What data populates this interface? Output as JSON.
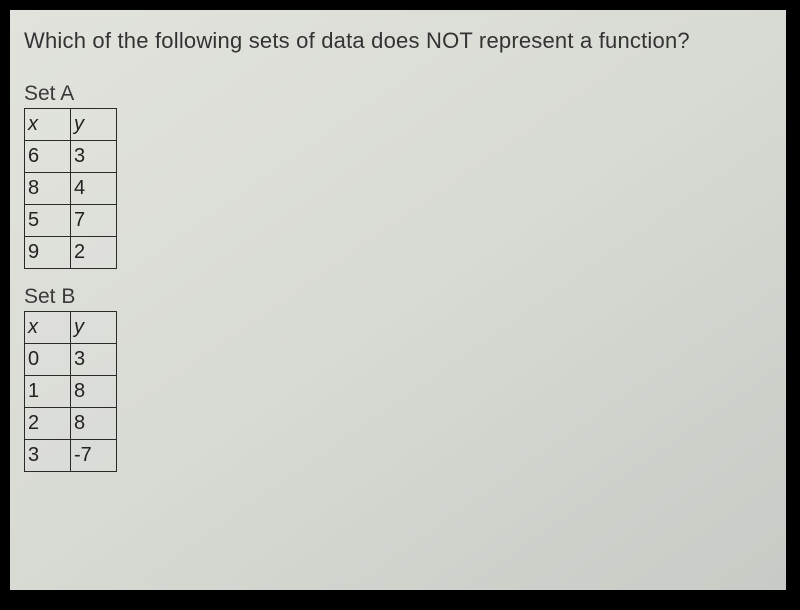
{
  "question": "Which of the following sets of data does NOT represent a function?",
  "sets": {
    "a": {
      "label": "Set A",
      "headers": {
        "x": "x",
        "y": "y"
      },
      "rows": [
        {
          "x": "6",
          "y": "3"
        },
        {
          "x": "8",
          "y": "4"
        },
        {
          "x": "5",
          "y": "7"
        },
        {
          "x": "9",
          "y": "2"
        }
      ]
    },
    "b": {
      "label": "Set B",
      "headers": {
        "x": "x",
        "y": "y"
      },
      "rows": [
        {
          "x": "0",
          "y": "3"
        },
        {
          "x": "1",
          "y": "8"
        },
        {
          "x": "2",
          "y": "8"
        },
        {
          "x": "3",
          "y": "-7"
        }
      ]
    }
  }
}
